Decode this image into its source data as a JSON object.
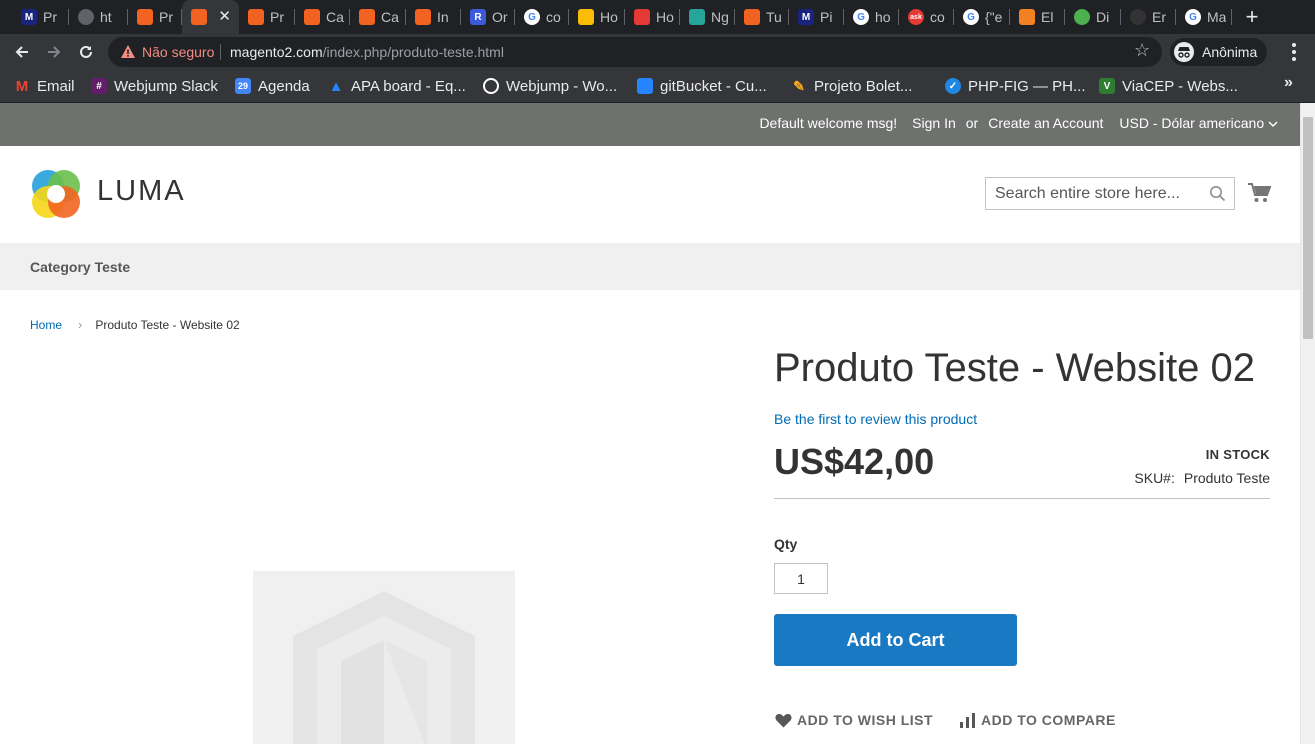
{
  "browser": {
    "tabs": [
      {
        "label": "Pr",
        "icon": "magento-m-icon",
        "color": "#1a237e"
      },
      {
        "label": "ht",
        "icon": "globe-icon",
        "color": "#5f6368"
      },
      {
        "label": "Pr",
        "icon": "magento-icon",
        "color": "#f26322"
      },
      {
        "label": "",
        "icon": "magento-icon",
        "color": "#f26322",
        "active": true
      },
      {
        "label": "Pr",
        "icon": "magento-dark-icon",
        "color": "#f26322"
      },
      {
        "label": "Ca",
        "icon": "magento-icon",
        "color": "#f26322"
      },
      {
        "label": "Ca",
        "icon": "magento-icon",
        "color": "#f26322"
      },
      {
        "label": "In",
        "icon": "magento-icon",
        "color": "#f26322"
      },
      {
        "label": "Or",
        "icon": "r-icon",
        "color": "#3b5bdb"
      },
      {
        "label": "co",
        "icon": "google-icon",
        "color": "#4285f4"
      },
      {
        "label": "Ho",
        "icon": "hotjar-icon",
        "color": "#fbbc05"
      },
      {
        "label": "Ho",
        "icon": "hostinger-icon",
        "color": "#e53935"
      },
      {
        "label": "Ng",
        "icon": "bird-icon",
        "color": "#26a69a"
      },
      {
        "label": "Tu",
        "icon": "magento-dark-icon",
        "color": "#f26322"
      },
      {
        "label": "Pi",
        "icon": "magento-m-icon",
        "color": "#1a237e"
      },
      {
        "label": "ho",
        "icon": "google-icon",
        "color": "#4285f4"
      },
      {
        "label": "co",
        "icon": "ask-icon",
        "color": "#e53935"
      },
      {
        "label": "{\"e",
        "icon": "google-icon",
        "color": "#4285f4"
      },
      {
        "label": "El",
        "icon": "stackoverflow-icon",
        "color": "#f48024"
      },
      {
        "label": "Di",
        "icon": "colorful-icon",
        "color": "#4caf50"
      },
      {
        "label": "Er",
        "icon": "github-icon",
        "color": "#333333"
      },
      {
        "label": "Ma",
        "icon": "google-icon",
        "color": "#4285f4"
      }
    ],
    "security_label": "Não seguro",
    "url_host": "magento2.com",
    "url_path": "/index.php/produto-teste.html",
    "profile_label": "Anônima",
    "bookmarks": [
      {
        "label": "Email",
        "icon": "gmail-icon",
        "color": "#ea4335"
      },
      {
        "label": "Webjump Slack",
        "icon": "slack-icon",
        "color": "#611f69"
      },
      {
        "label": "Agenda",
        "icon": "calendar-icon",
        "color": "#4285f4",
        "badge": "29"
      },
      {
        "label": "APA board - Eq...",
        "icon": "jira-icon",
        "color": "#2684ff"
      },
      {
        "label": "Webjump - Wo...",
        "icon": "webjump-icon",
        "color": "#ffffff"
      },
      {
        "label": "gitBucket - Cu...",
        "icon": "bitbucket-icon",
        "color": "#2684ff"
      },
      {
        "label": "Projeto Bolet...",
        "icon": "pencil-icon",
        "color": "#f9a825"
      },
      {
        "label": "PHP-FIG — PH...",
        "icon": "check-badge-icon",
        "color": "#1e88e5"
      },
      {
        "label": "ViaCEP - Webs...",
        "icon": "v-icon",
        "color": "#2e7d32"
      }
    ]
  },
  "store": {
    "welcome": "Default welcome msg!",
    "sign_in": "Sign In",
    "or": "or",
    "create_account": "Create an Account",
    "currency": "USD - Dólar americano",
    "brand": "LUMA",
    "search_placeholder": "Search entire store here...",
    "nav_item": "Category Teste",
    "breadcrumb_home": "Home",
    "breadcrumb_current": "Produto Teste - Website 02"
  },
  "product": {
    "title": "Produto Teste - Website 02",
    "review_link": "Be the first to review this product",
    "price": "US$42,00",
    "stock": "IN STOCK",
    "sku_label": "SKU#:",
    "sku_value": "Produto Teste",
    "qty_label": "Qty",
    "qty_value": "1",
    "add_to_cart": "Add to Cart",
    "wishlist": "ADD TO WISH LIST",
    "compare": "ADD TO COMPARE"
  },
  "colors": {
    "accent": "#1979c3",
    "link": "#006bb4",
    "panel": "#6e716e"
  }
}
